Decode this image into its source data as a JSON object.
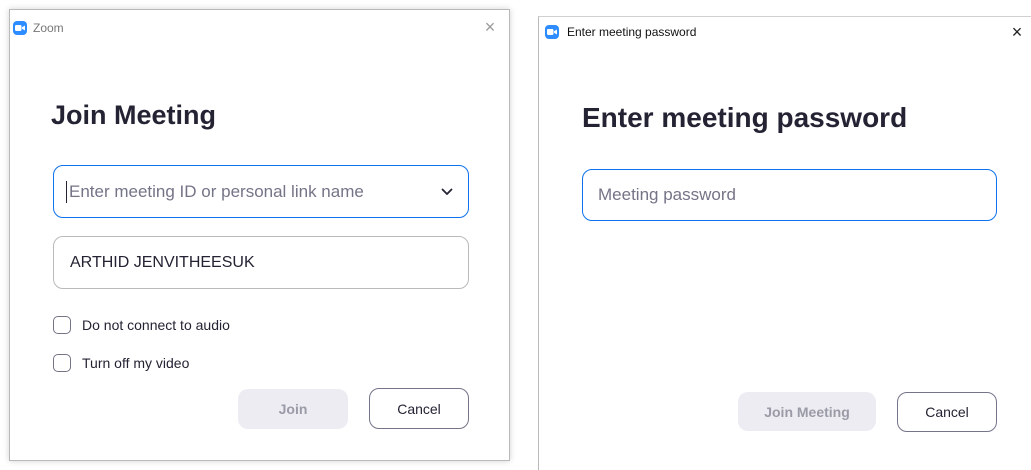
{
  "join_window": {
    "title": "Zoom",
    "close_glyph": "×",
    "heading": "Join Meeting",
    "meeting_id": {
      "value": "",
      "placeholder": "Enter meeting ID or personal link name"
    },
    "name": {
      "value": "ARTHID JENVITHEESUK"
    },
    "options": [
      {
        "label": "Do not connect to audio",
        "checked": false
      },
      {
        "label": "Turn off my video",
        "checked": false
      }
    ],
    "join_label": "Join",
    "cancel_label": "Cancel"
  },
  "password_window": {
    "title": "Enter meeting password",
    "close_glyph": "×",
    "heading": "Enter meeting password",
    "password": {
      "value": "",
      "placeholder": "Meeting password"
    },
    "join_label": "Join Meeting",
    "cancel_label": "Cancel"
  },
  "colors": {
    "accent": "#0e72ed",
    "zoom_icon": "#2d8cff",
    "disabled_button_bg": "#ececf2",
    "disabled_button_text": "#9b9ba8",
    "heading_text": "#232333"
  }
}
